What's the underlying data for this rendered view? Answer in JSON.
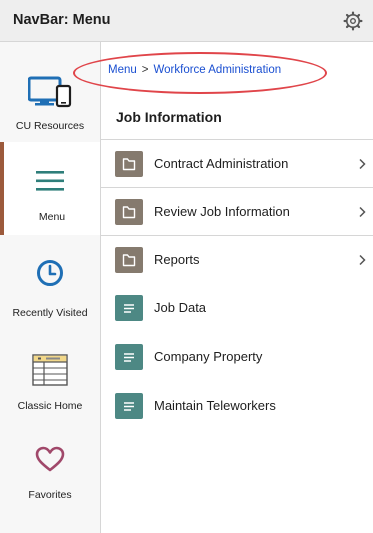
{
  "header": {
    "title": "NavBar: Menu"
  },
  "sidebar": {
    "items": [
      {
        "label": "CU Resources",
        "icon": "devices-icon"
      },
      {
        "label": "Menu",
        "icon": "hamburger-menu-icon",
        "active": true
      },
      {
        "label": "Recently Visited",
        "icon": "clock-icon"
      },
      {
        "label": "Classic Home",
        "icon": "classic-home-icon"
      },
      {
        "label": "Favorites",
        "icon": "heart-icon"
      }
    ]
  },
  "breadcrumb": {
    "root": "Menu",
    "separator": ">",
    "current": "Workforce Administration"
  },
  "main": {
    "title": "Job Information",
    "items": [
      {
        "label": "Contract Administration",
        "type": "folder",
        "has_children": true
      },
      {
        "label": "Review Job Information",
        "type": "folder",
        "has_children": true
      },
      {
        "label": "Reports",
        "type": "folder",
        "has_children": true
      },
      {
        "label": "Job Data",
        "type": "page",
        "has_children": false
      },
      {
        "label": "Company Property",
        "type": "page",
        "has_children": false
      },
      {
        "label": "Maintain Teleworkers",
        "type": "page",
        "has_children": false
      }
    ]
  },
  "colors": {
    "accent_active": "#9c5a3c",
    "folder_icon": "#857a6e",
    "page_icon": "#4d8884",
    "link": "#1a4fd1",
    "highlight_oval": "#e0454a",
    "icon_blue": "#1f6fb5",
    "icon_teal": "#2e7e7a",
    "icon_heart": "#a0486a"
  }
}
